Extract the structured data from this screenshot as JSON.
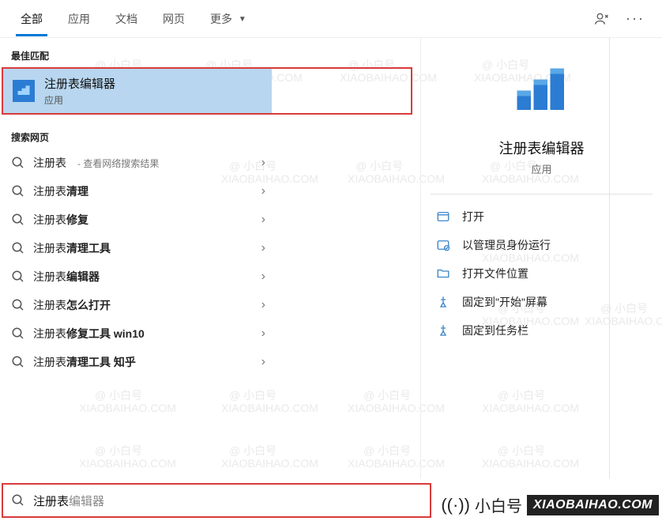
{
  "tabs": {
    "items": [
      {
        "label": "全部",
        "active": true
      },
      {
        "label": "应用"
      },
      {
        "label": "文档"
      },
      {
        "label": "网页"
      },
      {
        "label": "更多",
        "dropdown": true
      }
    ]
  },
  "sections": {
    "best_match_header": "最佳匹配",
    "search_web_header": "搜索网页"
  },
  "best_match": {
    "title": "注册表编辑器",
    "subtitle": "应用"
  },
  "web_results": [
    {
      "prefix": "注册表",
      "bold": "",
      "suffix_label": " - 查看网络搜索结果"
    },
    {
      "prefix": "注册表",
      "bold": "清理"
    },
    {
      "prefix": "注册表",
      "bold": "修复"
    },
    {
      "prefix": "注册表",
      "bold": "清理工具"
    },
    {
      "prefix": "注册表",
      "bold": "编辑器"
    },
    {
      "prefix": "注册表",
      "bold": "怎么打开"
    },
    {
      "prefix": "注册表",
      "bold": "修复工具 win10"
    },
    {
      "prefix": "注册表",
      "bold": "清理工具 知乎"
    }
  ],
  "preview": {
    "title": "注册表编辑器",
    "subtitle": "应用",
    "actions": [
      {
        "icon": "open-icon",
        "label": "打开"
      },
      {
        "icon": "run-admin-icon",
        "label": "以管理员身份运行"
      },
      {
        "icon": "open-location-icon",
        "label": "打开文件位置"
      },
      {
        "icon": "pin-start-icon",
        "label": "固定到\"开始\"屏幕"
      },
      {
        "icon": "pin-taskbar-icon",
        "label": "固定到任务栏"
      }
    ]
  },
  "search": {
    "typed": "注册表",
    "suggest": "编辑器"
  },
  "brand": {
    "name": "小白号",
    "url": "XIAOBAIHAO.COM"
  },
  "watermark": {
    "text_cn": "@ 小白号",
    "text_en": "XIAOBAIHAO.COM"
  }
}
